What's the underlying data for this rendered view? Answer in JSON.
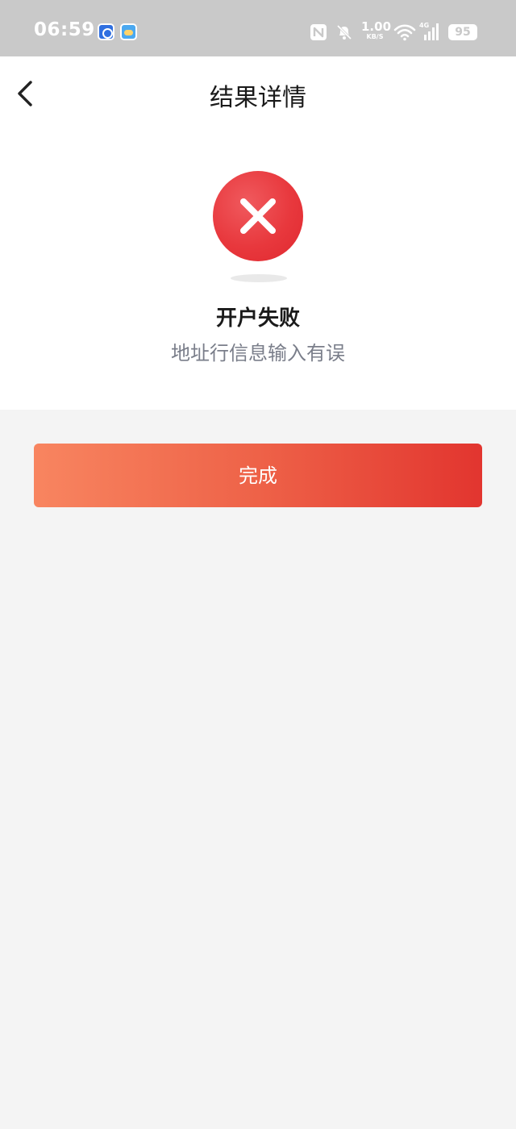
{
  "status_bar": {
    "time": "06:59",
    "app_icons": [
      "calendar-app-icon",
      "weather-app-icon"
    ],
    "network_speed": "1.00",
    "network_speed_unit": "KB/S",
    "signal_label": "4G",
    "battery": "95"
  },
  "header": {
    "title": "结果详情",
    "back_icon": "chevron-left-icon"
  },
  "result": {
    "icon": "error-x-icon",
    "title": "开户失败",
    "message": "地址行信息输入有误"
  },
  "actions": {
    "done_label": "完成"
  },
  "colors": {
    "accent_start": "#f88560",
    "accent_end": "#e2352f",
    "error": "#e8383d",
    "background": "#f4f4f4"
  }
}
